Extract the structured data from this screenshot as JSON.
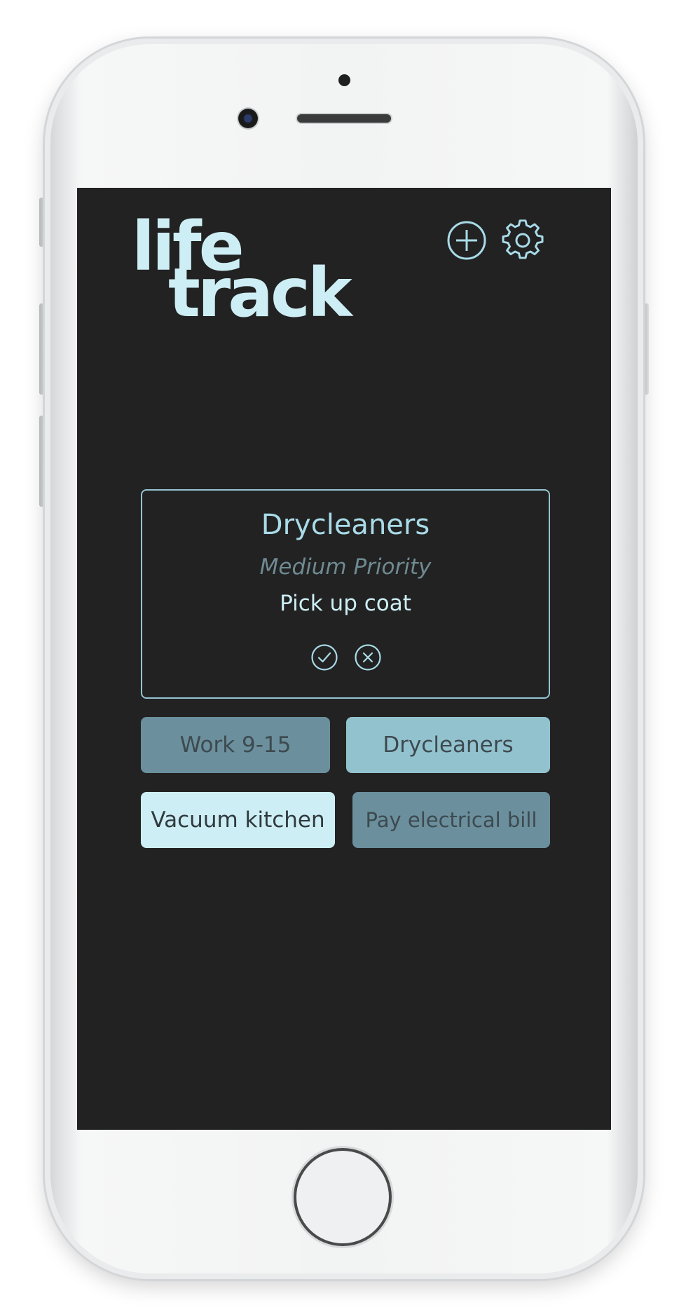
{
  "app": {
    "logo_line1": "life",
    "logo_line2": "track",
    "icons": {
      "add": "plus-circle-icon",
      "settings": "gear-icon"
    }
  },
  "task_card": {
    "title": "Drycleaners",
    "priority": "Medium Priority",
    "description": "Pick up coat",
    "actions": {
      "done": "check-circle-icon",
      "dismiss": "x-circle-icon"
    }
  },
  "tasks": [
    {
      "label": "Work 9-15"
    },
    {
      "label": "Drycleaners"
    },
    {
      "label": "Vacuum kitchen"
    },
    {
      "label": "Pay electrical bill"
    }
  ],
  "colors": {
    "screen_bg": "#222222",
    "accent_light": "#cdeef4",
    "accent": "#93c2cf",
    "accent_dark": "#6b8f9d"
  }
}
